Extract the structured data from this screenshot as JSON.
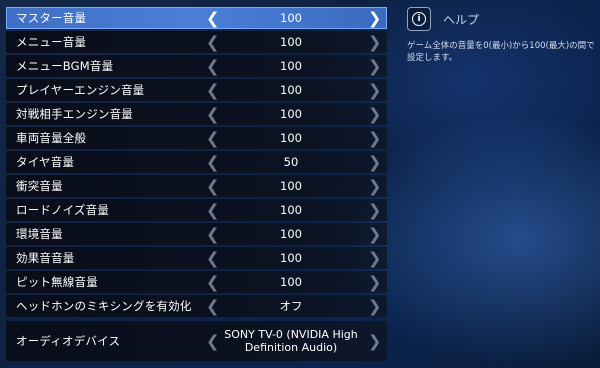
{
  "settings": [
    {
      "label": "マスター音量",
      "value": "100",
      "selected": true
    },
    {
      "label": "メニュー音量",
      "value": "100"
    },
    {
      "label": "メニューBGM音量",
      "value": "100"
    },
    {
      "label": "プレイヤーエンジン音量",
      "value": "100"
    },
    {
      "label": "対戦相手エンジン音量",
      "value": "100"
    },
    {
      "label": "車両音量全般",
      "value": "100"
    },
    {
      "label": "タイヤ音量",
      "value": "50"
    },
    {
      "label": "衝突音量",
      "value": "100"
    },
    {
      "label": "ロードノイズ音量",
      "value": "100"
    },
    {
      "label": "環境音量",
      "value": "100"
    },
    {
      "label": "効果音音量",
      "value": "100"
    },
    {
      "label": "ピット無線音量",
      "value": "100"
    },
    {
      "label": "ヘッドホンのミキシングを有効化",
      "value": "オフ"
    },
    {
      "label": "オーディオデバイス",
      "value": "SONY TV-0 (NVIDIA High Definition Audio)"
    }
  ],
  "arrows": {
    "left": "❮",
    "right": "❯"
  },
  "help": {
    "icon": "info-icon",
    "icon_glyph": "i",
    "title": "ヘルプ",
    "text": "ゲーム全体の音量を0(最小)から100(最大)の間で設定します。"
  },
  "colors": {
    "selected": "#4a7fd6",
    "row_bg": "#0a0e18",
    "arrow_inactive": "#6e7a90"
  }
}
